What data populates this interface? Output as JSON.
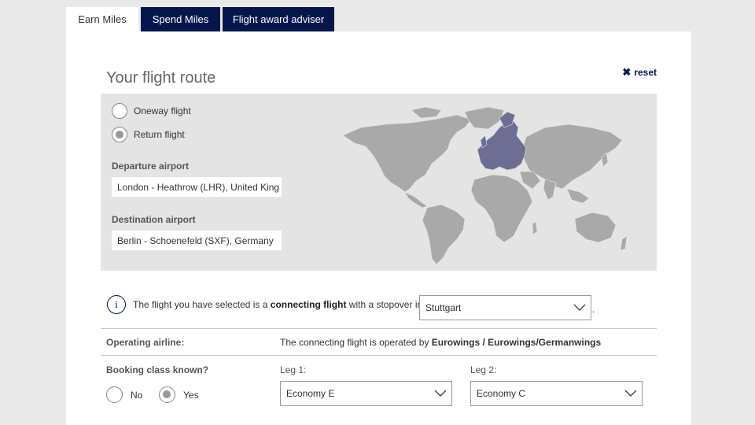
{
  "tabs": [
    {
      "label": "Earn Miles"
    },
    {
      "label": "Spend Miles"
    },
    {
      "label": "Flight award adviser"
    }
  ],
  "route": {
    "title": "Your flight route",
    "reset_label": "reset",
    "oneway_label": "Oneway flight",
    "return_label": "Return flight",
    "selected_trip": "Return flight",
    "departure_label": "Departure airport",
    "departure_value": "London - Heathrow (LHR), United King",
    "destination_label": "Destination airport",
    "destination_value": "Berlin - Schoenefeld (SXF), Germany"
  },
  "info": {
    "text_before": "The flight you have selected is a ",
    "text_bold": "connecting flight",
    "text_after": " with a stopover in",
    "stopover": "Stuttgart",
    "trailing": "."
  },
  "operating": {
    "label": "Operating airline:",
    "text_before": "The connecting flight is operated by ",
    "airline": "Eurowings / Eurowings/Germanwings"
  },
  "booking": {
    "label": "Booking class known?",
    "no_label": "No",
    "yes_label": "Yes",
    "selected": "Yes",
    "leg1_label": "Leg 1:",
    "leg1_value": "Economy E",
    "leg2_label": "Leg 2:",
    "leg2_value": "Economy C"
  },
  "colors": {
    "brand_dark": "#05164d",
    "map_land": "#a9a9a9",
    "map_highlight": "#6e6e94",
    "map_bg": "#e4e4e4"
  }
}
